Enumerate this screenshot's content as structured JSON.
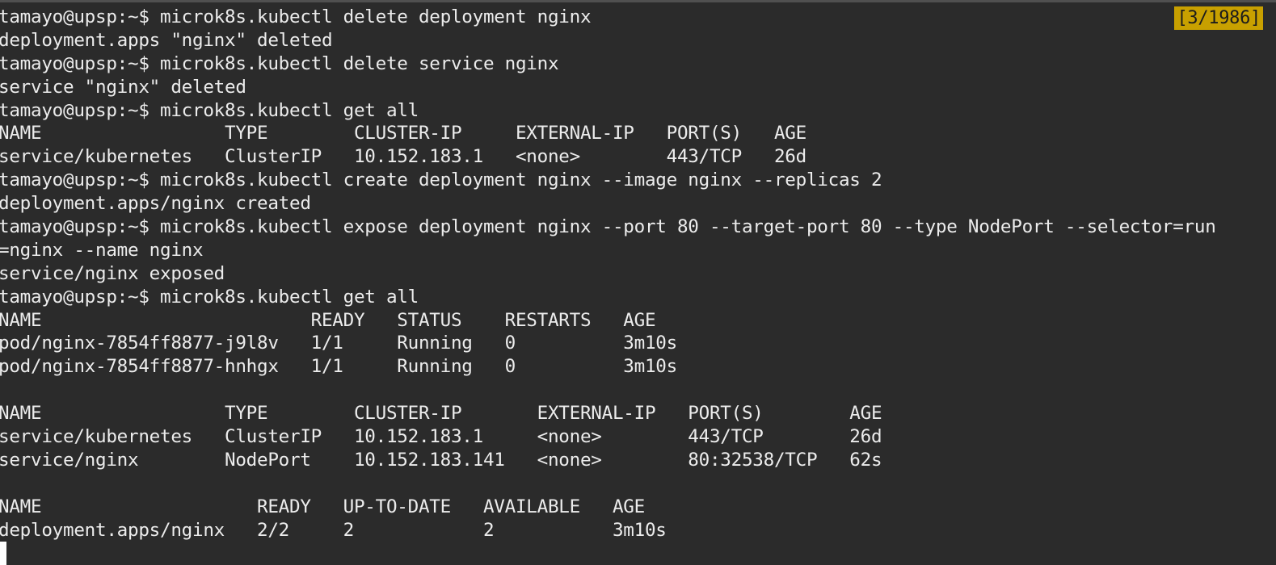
{
  "terminal": {
    "scroll_indicator": "[3/1986]",
    "lines": [
      "tamayo@upsp:~$ microk8s.kubectl delete deployment nginx",
      "deployment.apps \"nginx\" deleted",
      "tamayo@upsp:~$ microk8s.kubectl delete service nginx",
      "service \"nginx\" deleted",
      "tamayo@upsp:~$ microk8s.kubectl get all",
      "NAME                 TYPE        CLUSTER-IP     EXTERNAL-IP   PORT(S)   AGE",
      "service/kubernetes   ClusterIP   10.152.183.1   <none>        443/TCP   26d",
      "tamayo@upsp:~$ microk8s.kubectl create deployment nginx --image nginx --replicas 2",
      "deployment.apps/nginx created",
      "tamayo@upsp:~$ microk8s.kubectl expose deployment nginx --port 80 --target-port 80 --type NodePort --selector=run",
      "=nginx --name nginx",
      "service/nginx exposed",
      "tamayo@upsp:~$ microk8s.kubectl get all",
      "NAME                         READY   STATUS    RESTARTS   AGE",
      "pod/nginx-7854ff8877-j9l8v   1/1     Running   0          3m10s",
      "pod/nginx-7854ff8877-hnhgx   1/1     Running   0          3m10s",
      "",
      "NAME                 TYPE        CLUSTER-IP       EXTERNAL-IP   PORT(S)        AGE",
      "service/kubernetes   ClusterIP   10.152.183.1     <none>        443/TCP        26d",
      "service/nginx        NodePort    10.152.183.141   <none>        80:32538/TCP   62s",
      "",
      "NAME                    READY   UP-TO-DATE   AVAILABLE   AGE",
      "deployment.apps/nginx   2/2     2            2           3m10s"
    ]
  }
}
